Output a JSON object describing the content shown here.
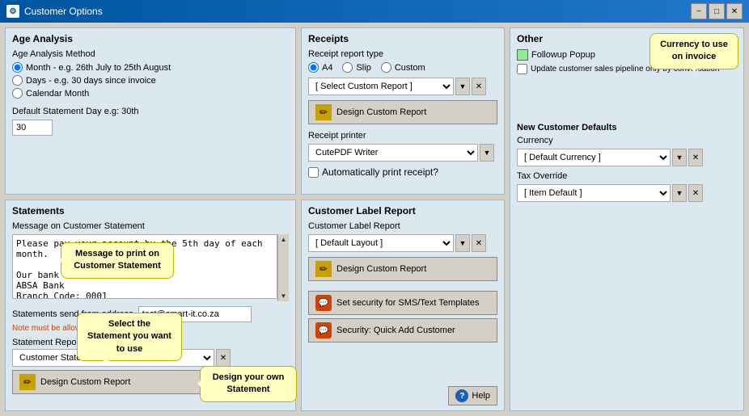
{
  "titleBar": {
    "title": "Customer Options",
    "icon": "⚙",
    "minimizeLabel": "−",
    "maximizeLabel": "□",
    "closeLabel": "✕"
  },
  "ageAnalysis": {
    "title": "Age Analysis",
    "sectionLabel": "Age Analysis Method",
    "options": [
      {
        "label": "Month - e.g. 26th July to 25th August",
        "checked": true
      },
      {
        "label": "Days - e.g. 30 days since invoice",
        "checked": false
      },
      {
        "label": "Calendar Month",
        "checked": false
      }
    ],
    "defaultDayLabel": "Default Statement Day e.g: 30th",
    "defaultDayValue": "30"
  },
  "receipts": {
    "title": "Receipts",
    "reportTypeLabel": "Receipt report type",
    "radioOptions": [
      {
        "label": "A4",
        "checked": true
      },
      {
        "label": "Slip",
        "checked": false
      },
      {
        "label": "Custom",
        "checked": false
      }
    ],
    "customReportSelect": "[ Select Custom Report ]",
    "designBtnLabel": "Design Custom Report",
    "printerLabel": "Receipt printer",
    "printerValue": "CutePDF Writer",
    "autoPrintLabel": "Automatically print receipt?",
    "autoPrintChecked": false
  },
  "other": {
    "title": "Other",
    "followupLabel": "Followup Popup",
    "followupChecked": true,
    "updatePipelineLabel": "Update customer sales pipeline only by conversation",
    "updatePipelineChecked": false,
    "newCustomerDefaultsLabel": "New Customer Defaults",
    "currencyLabel": "Currency",
    "currencyValue": "[ Default Currency ]",
    "taxOverrideLabel": "Tax Override",
    "taxOverrideValue": "[ Item Default ]",
    "currencyBalloon": "Currency to use on invoice"
  },
  "statements": {
    "title": "Statements",
    "msgLabel": "Message on Customer Statement",
    "msgValue": "Please pay your account by the 5th day of each month.\n\nOur bank details are:\nABSA Bank\nBranch Code: 0001",
    "msgBalloon": "Message to print on\nCustomer Statement",
    "sendFromLabel": "Statements send from address",
    "sendFromValue": "test@smart-it.co.za",
    "noteText": "Note must be allowed to...",
    "reportLabel": "Statement Report",
    "reportValue": "Customer Statement O-no current",
    "selectBalloon": "Select the Statement\nyou want to use",
    "designBtnLabel": "Design Custom Report",
    "designBalloon": "Design your own\nStatement"
  },
  "customerLabel": {
    "title": "Customer Label Report",
    "reportLabel": "Customer Label Report",
    "reportValue": "[ Default Layout ]",
    "designBtnLabel": "Design Custom Report"
  },
  "smsSection": {
    "smsLabel": "Set security for SMS/Text Templates",
    "quickAddLabel": "Security: Quick Add Customer"
  },
  "bottom": {
    "helpLabel": "Help"
  }
}
